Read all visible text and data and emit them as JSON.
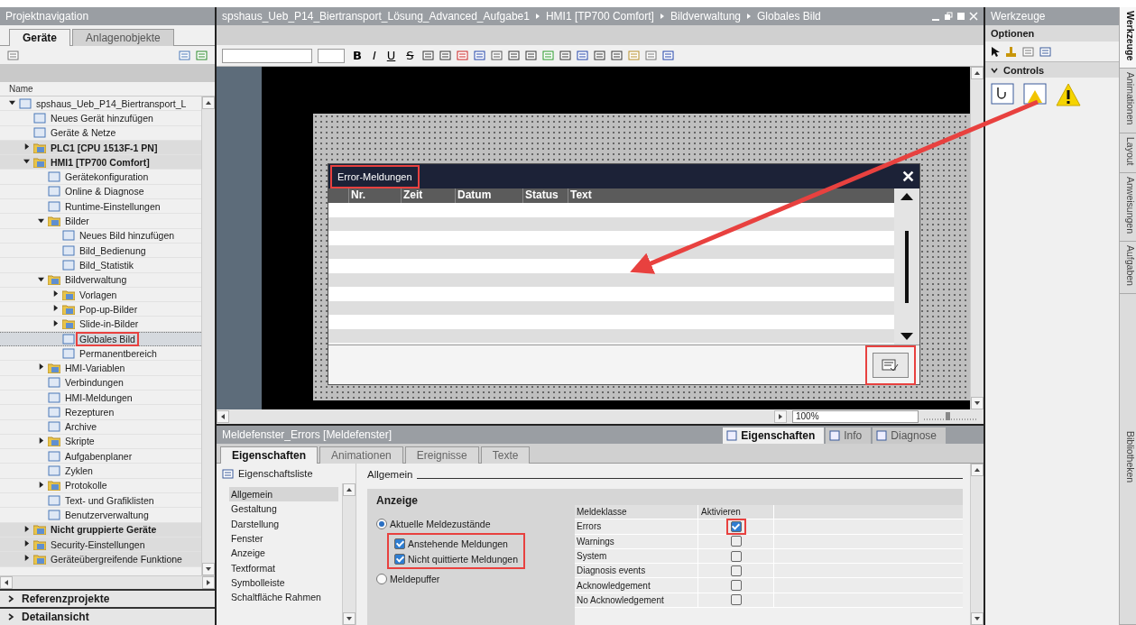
{
  "nav": {
    "title": "Projektnavigation",
    "tabs": [
      {
        "label": "Geräte",
        "selected": true
      },
      {
        "label": "Anlagenobjekte",
        "selected": false
      }
    ],
    "column": "Name",
    "tree": [
      {
        "label": "spshaus_Ueb_P14_Biertransport_L",
        "kind": "item",
        "selected": false,
        "expanded": true,
        "children": [
          {
            "label": "Neues Gerät hinzufügen",
            "kind": "item",
            "selected": false
          },
          {
            "label": "Geräte & Netze",
            "kind": "item",
            "selected": false
          },
          {
            "label": "PLC1 [CPU 1513F-1 PN]",
            "kind": "device",
            "selected": false,
            "expanded": false
          },
          {
            "label": "HMI1 [TP700 Comfort]",
            "kind": "device",
            "selected": false,
            "expanded": true,
            "children": [
              {
                "label": "Gerätekonfiguration",
                "kind": "item",
                "selected": false
              },
              {
                "label": "Online & Diagnose",
                "kind": "item",
                "selected": false
              },
              {
                "label": "Runtime-Einstellungen",
                "kind": "item",
                "selected": false
              },
              {
                "label": "Bilder",
                "kind": "item",
                "selected": false,
                "expanded": true,
                "children": [
                  {
                    "label": "Neues Bild hinzufügen",
                    "kind": "item",
                    "selected": false
                  },
                  {
                    "label": "Bild_Bedienung",
                    "kind": "item",
                    "selected": false
                  },
                  {
                    "label": "Bild_Statistik",
                    "kind": "item",
                    "selected": false
                  }
                ]
              },
              {
                "label": "Bildverwaltung",
                "kind": "item",
                "selected": false,
                "expanded": true,
                "children": [
                  {
                    "label": "Vorlagen",
                    "kind": "item",
                    "selected": false,
                    "expanded": false
                  },
                  {
                    "label": "Pop-up-Bilder",
                    "kind": "item",
                    "selected": false,
                    "expanded": false
                  },
                  {
                    "label": "Slide-in-Bilder",
                    "kind": "item",
                    "selected": false,
                    "expanded": false
                  },
                  {
                    "label": "Globales Bild",
                    "kind": "item",
                    "selected": true,
                    "highlighted": true
                  },
                  {
                    "label": "Permanentbereich",
                    "kind": "item",
                    "selected": false
                  }
                ]
              },
              {
                "label": "HMI-Variablen",
                "kind": "item",
                "selected": false,
                "expanded": false
              },
              {
                "label": "Verbindungen",
                "kind": "item",
                "selected": false
              },
              {
                "label": "HMI-Meldungen",
                "kind": "item",
                "selected": false
              },
              {
                "label": "Rezepturen",
                "kind": "item",
                "selected": false
              },
              {
                "label": "Archive",
                "kind": "item",
                "selected": false
              },
              {
                "label": "Skripte",
                "kind": "item",
                "selected": false,
                "expanded": false
              },
              {
                "label": "Aufgabenplaner",
                "kind": "item",
                "selected": false
              },
              {
                "label": "Zyklen",
                "kind": "item",
                "selected": false
              },
              {
                "label": "Protokolle",
                "kind": "item",
                "selected": false,
                "expanded": false
              },
              {
                "label": "Text- und Grafiklisten",
                "kind": "item",
                "selected": false
              },
              {
                "label": "Benutzerverwaltung",
                "kind": "item",
                "selected": false
              }
            ]
          },
          {
            "label": "Nicht gruppierte Geräte",
            "kind": "device",
            "selected": false,
            "expanded": false
          },
          {
            "label": "Security-Einstellungen",
            "kind": "group",
            "selected": false,
            "expanded": false
          },
          {
            "label": "Geräteübergreifende Funktione",
            "kind": "group",
            "selected": false,
            "expanded": false
          }
        ]
      }
    ],
    "sections": [
      {
        "label": "Referenzprojekte",
        "expanded": false
      },
      {
        "label": "Detailansicht",
        "expanded": false
      }
    ]
  },
  "editor": {
    "breadcrumb": [
      "spshaus_Ueb_P14_Biertransport_Lösung_Advanced_Aufgabe1",
      "HMI1 [TP700 Comfort]",
      "Bildverwaltung",
      "Globales Bild"
    ],
    "format_buttons": [
      "B",
      "I",
      "U",
      "S"
    ],
    "zoom": "100%",
    "alarm_view": {
      "title": "Error-Meldungen",
      "title_highlighted": true,
      "close": "✕",
      "columns": [
        "Nr.",
        "Zeit",
        "Datum",
        "Status",
        "Text"
      ],
      "button_highlighted": true
    }
  },
  "properties": {
    "title": "Meldefenster_Errors [Meldefenster]",
    "view_tabs": [
      {
        "label": "Eigenschaften",
        "selected": true
      },
      {
        "label": "Info",
        "selected": false
      },
      {
        "label": "Diagnose",
        "selected": false
      }
    ],
    "tabs": [
      {
        "label": "Eigenschaften",
        "selected": true
      },
      {
        "label": "Animationen",
        "selected": false
      },
      {
        "label": "Ereignisse",
        "selected": false
      },
      {
        "label": "Texte",
        "selected": false
      }
    ],
    "list_title": "Eigenschaftsliste",
    "list": [
      {
        "label": "Allgemein",
        "selected": true
      },
      {
        "label": "Gestaltung",
        "selected": false
      },
      {
        "label": "Darstellung",
        "selected": false
      },
      {
        "label": "Fenster",
        "selected": false
      },
      {
        "label": "Anzeige",
        "selected": false
      },
      {
        "label": "Textformat",
        "selected": false
      },
      {
        "label": "Symbolleiste",
        "selected": false
      },
      {
        "label": "Schaltfläche Rahmen",
        "selected": false
      }
    ],
    "section": "Allgemein",
    "group": "Anzeige",
    "options": [
      {
        "label": "Aktuelle Meldezustände",
        "selected": true,
        "suboptions_highlighted": true,
        "suboptions": [
          {
            "label": "Anstehende Meldungen",
            "checked": true
          },
          {
            "label": "Nicht quittierte Meldungen",
            "checked": true
          }
        ]
      },
      {
        "label": "Meldepuffer",
        "selected": false
      }
    ],
    "class_table": {
      "columns": [
        "Meldeklasse",
        "Aktivieren"
      ],
      "rows": [
        {
          "name": "Errors",
          "checked": true,
          "highlighted": true
        },
        {
          "name": "Warnings",
          "checked": false,
          "highlighted": false
        },
        {
          "name": "System",
          "checked": false,
          "highlighted": false
        },
        {
          "name": "Diagnosis events",
          "checked": false,
          "highlighted": false
        },
        {
          "name": "Acknowledgement",
          "checked": false,
          "highlighted": false
        },
        {
          "name": "No Acknowledgement",
          "checked": false,
          "highlighted": false
        }
      ]
    }
  },
  "tools": {
    "title": "Werkzeuge",
    "options": "Optionen",
    "section": {
      "label": "Controls",
      "expanded": true
    }
  },
  "side_tabs": [
    {
      "label": "Werkzeuge",
      "selected": true
    },
    {
      "label": "Animationen",
      "selected": false
    },
    {
      "label": "Layout",
      "selected": false
    },
    {
      "label": "Anweisungen",
      "selected": false
    },
    {
      "label": "Aufgaben",
      "selected": false
    },
    {
      "label": "Bibliotheken",
      "selected": false
    }
  ]
}
